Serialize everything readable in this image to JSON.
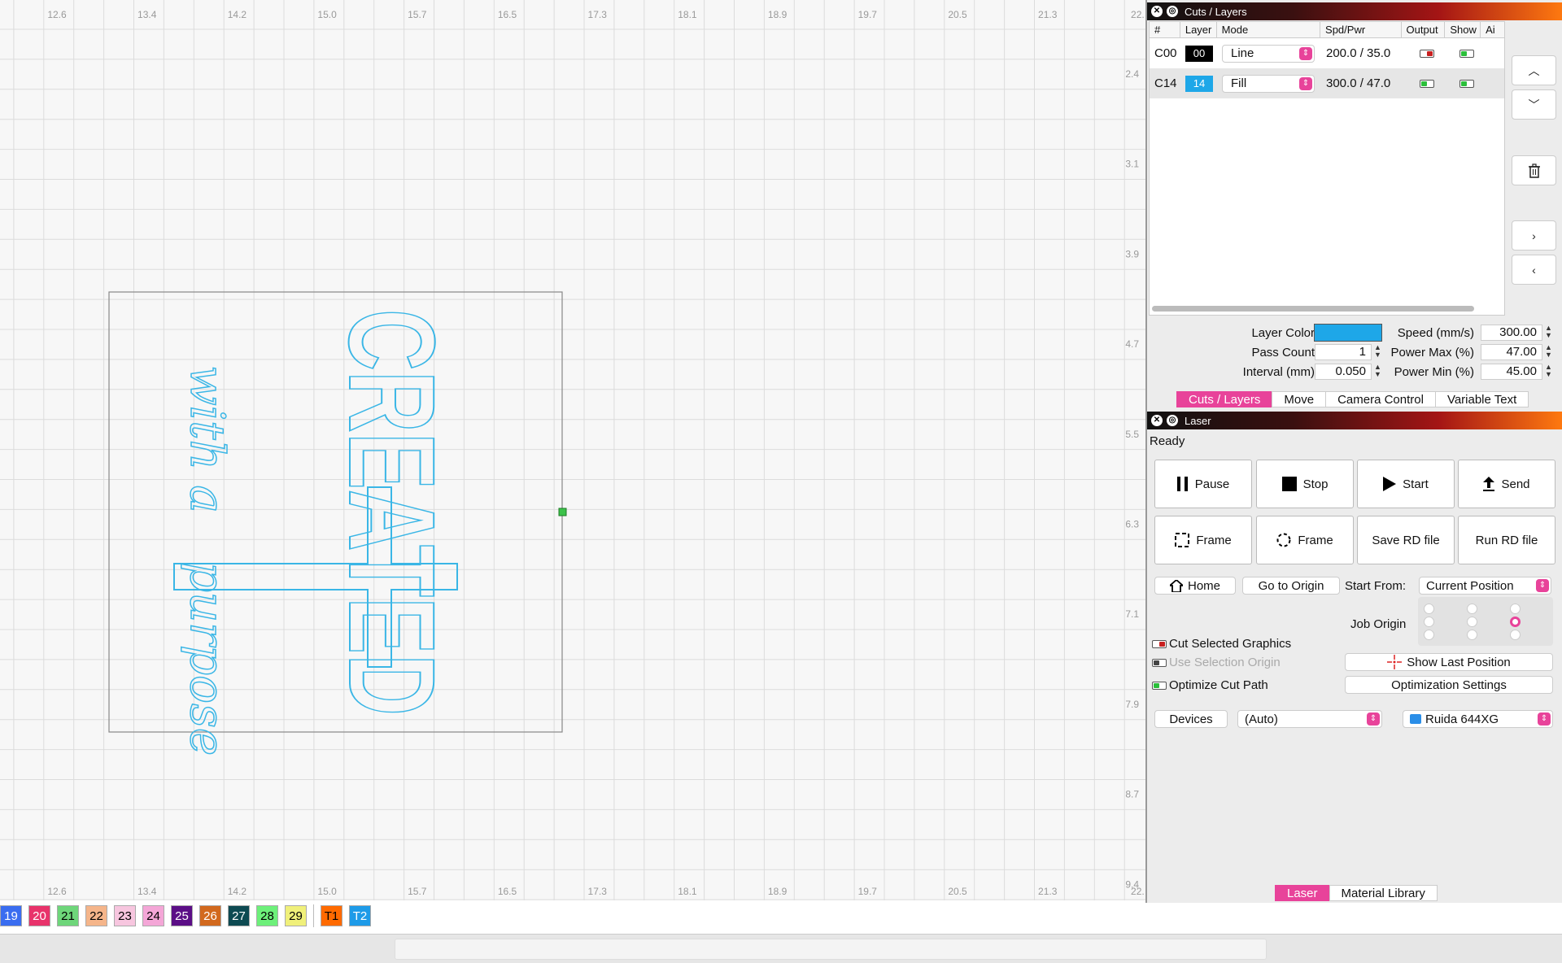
{
  "ruler": {
    "x_labels": [
      "12.6",
      "13.4",
      "14.2",
      "15.0",
      "15.7",
      "16.5",
      "17.3",
      "18.1",
      "18.9",
      "19.7",
      "20.5",
      "21.3",
      "22."
    ],
    "y_labels": [
      "2.4",
      "3.1",
      "3.9",
      "4.7",
      "5.5",
      "6.3",
      "7.1",
      "7.9",
      "8.7",
      "9.4"
    ]
  },
  "palette": {
    "swatches": [
      {
        "label": "19",
        "color": "#3a6df0",
        "dark": true
      },
      {
        "label": "20",
        "color": "#e8336b",
        "dark": true
      },
      {
        "label": "21",
        "color": "#6ed67a",
        "dark": false
      },
      {
        "label": "22",
        "color": "#f5b58a",
        "dark": false
      },
      {
        "label": "23",
        "color": "#f7c6df",
        "dark": false
      },
      {
        "label": "24",
        "color": "#f4a6d7",
        "dark": false
      },
      {
        "label": "25",
        "color": "#5b0e86",
        "dark": true
      },
      {
        "label": "26",
        "color": "#d2691e",
        "dark": true
      },
      {
        "label": "27",
        "color": "#0d4a52",
        "dark": true
      },
      {
        "label": "28",
        "color": "#6df07a",
        "dark": false
      },
      {
        "label": "29",
        "color": "#f0f07a",
        "dark": false
      }
    ],
    "tools": [
      {
        "label": "T1",
        "color": "#ff6a00",
        "dark": false
      },
      {
        "label": "T2",
        "color": "#1e9be8",
        "dark": true
      }
    ]
  },
  "cuts": {
    "title": "Cuts / Layers",
    "headers": [
      "#",
      "Layer",
      "Mode",
      "Spd/Pwr",
      "Output",
      "Show",
      "Ai"
    ],
    "rows": [
      {
        "num": "C00",
        "layer": "00",
        "layer_color": "#000000",
        "mode": "Line",
        "spdpwr": "200.0 / 35.0",
        "output": "off",
        "show": "on"
      },
      {
        "num": "C14",
        "layer": "14",
        "layer_color": "#1ea7e8",
        "mode": "Fill",
        "spdpwr": "300.0 / 47.0",
        "output": "on",
        "show": "on"
      }
    ]
  },
  "layer_settings": {
    "layer_color_label": "Layer Color",
    "layer_color": "#1ea7e8",
    "pass_count_label": "Pass Count",
    "pass_count": "1",
    "interval_label": "Interval (mm)",
    "interval": "0.050",
    "speed_label": "Speed (mm/s)",
    "speed": "300.00",
    "power_max_label": "Power Max (%)",
    "power_max": "47.00",
    "power_min_label": "Power Min (%)",
    "power_min": "45.00"
  },
  "top_tabs": [
    "Cuts / Layers",
    "Move",
    "Camera Control",
    "Variable Text"
  ],
  "laser": {
    "title": "Laser",
    "status": "Ready",
    "pause": "Pause",
    "stop": "Stop",
    "start": "Start",
    "send": "Send",
    "frame1": "Frame",
    "frame2": "Frame",
    "save_rd": "Save RD file",
    "run_rd": "Run RD file",
    "home": "Home",
    "go_origin": "Go to Origin",
    "start_from_label": "Start From:",
    "start_from": "Current Position",
    "job_origin": "Job Origin",
    "cut_selected": "Cut Selected Graphics",
    "use_selection_origin": "Use Selection Origin",
    "optimize_cut": "Optimize Cut Path",
    "show_last_pos": "Show Last Position",
    "opt_settings": "Optimization Settings",
    "devices": "Devices",
    "device_sel": "(Auto)",
    "controller": "Ruida 644XG"
  },
  "bottom_tabs": [
    "Laser",
    "Material Library"
  ],
  "colors": {
    "accent": "#e8439a",
    "design": "#3ab6e6"
  },
  "design_text": {
    "main": "CREATED",
    "script1": "with a",
    "script2": "purpose"
  }
}
